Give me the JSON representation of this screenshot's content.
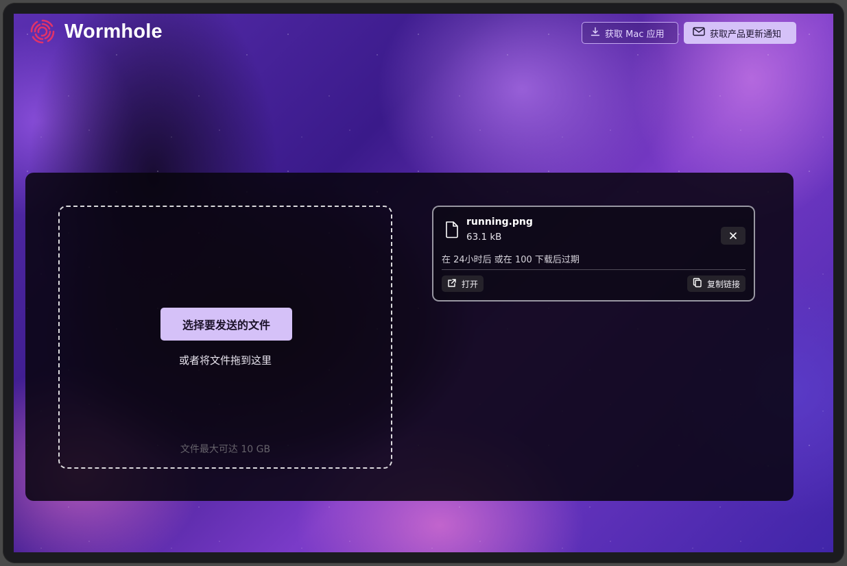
{
  "app": {
    "title": "Wormhole"
  },
  "header": {
    "mac_app_label": "获取 Mac 应用",
    "notify_label": "获取产品更新通知"
  },
  "dropzone": {
    "choose_label": "选择要发送的文件",
    "drag_hint": "或者将文件拖到这里",
    "max_size": "文件最大可达 10 GB"
  },
  "file": {
    "name": "running.png",
    "size": "63.1 kB",
    "expiry": "在 24小时后 或在 100 下载后过期",
    "open_label": "打开",
    "copy_label": "复制链接"
  },
  "colors": {
    "accent": "#d5c1f8",
    "logo": "#e0336a"
  },
  "icons": [
    "wormhole-logo-icon",
    "download-icon",
    "mail-icon",
    "file-icon",
    "close-icon",
    "external-link-icon",
    "copy-icon"
  ]
}
